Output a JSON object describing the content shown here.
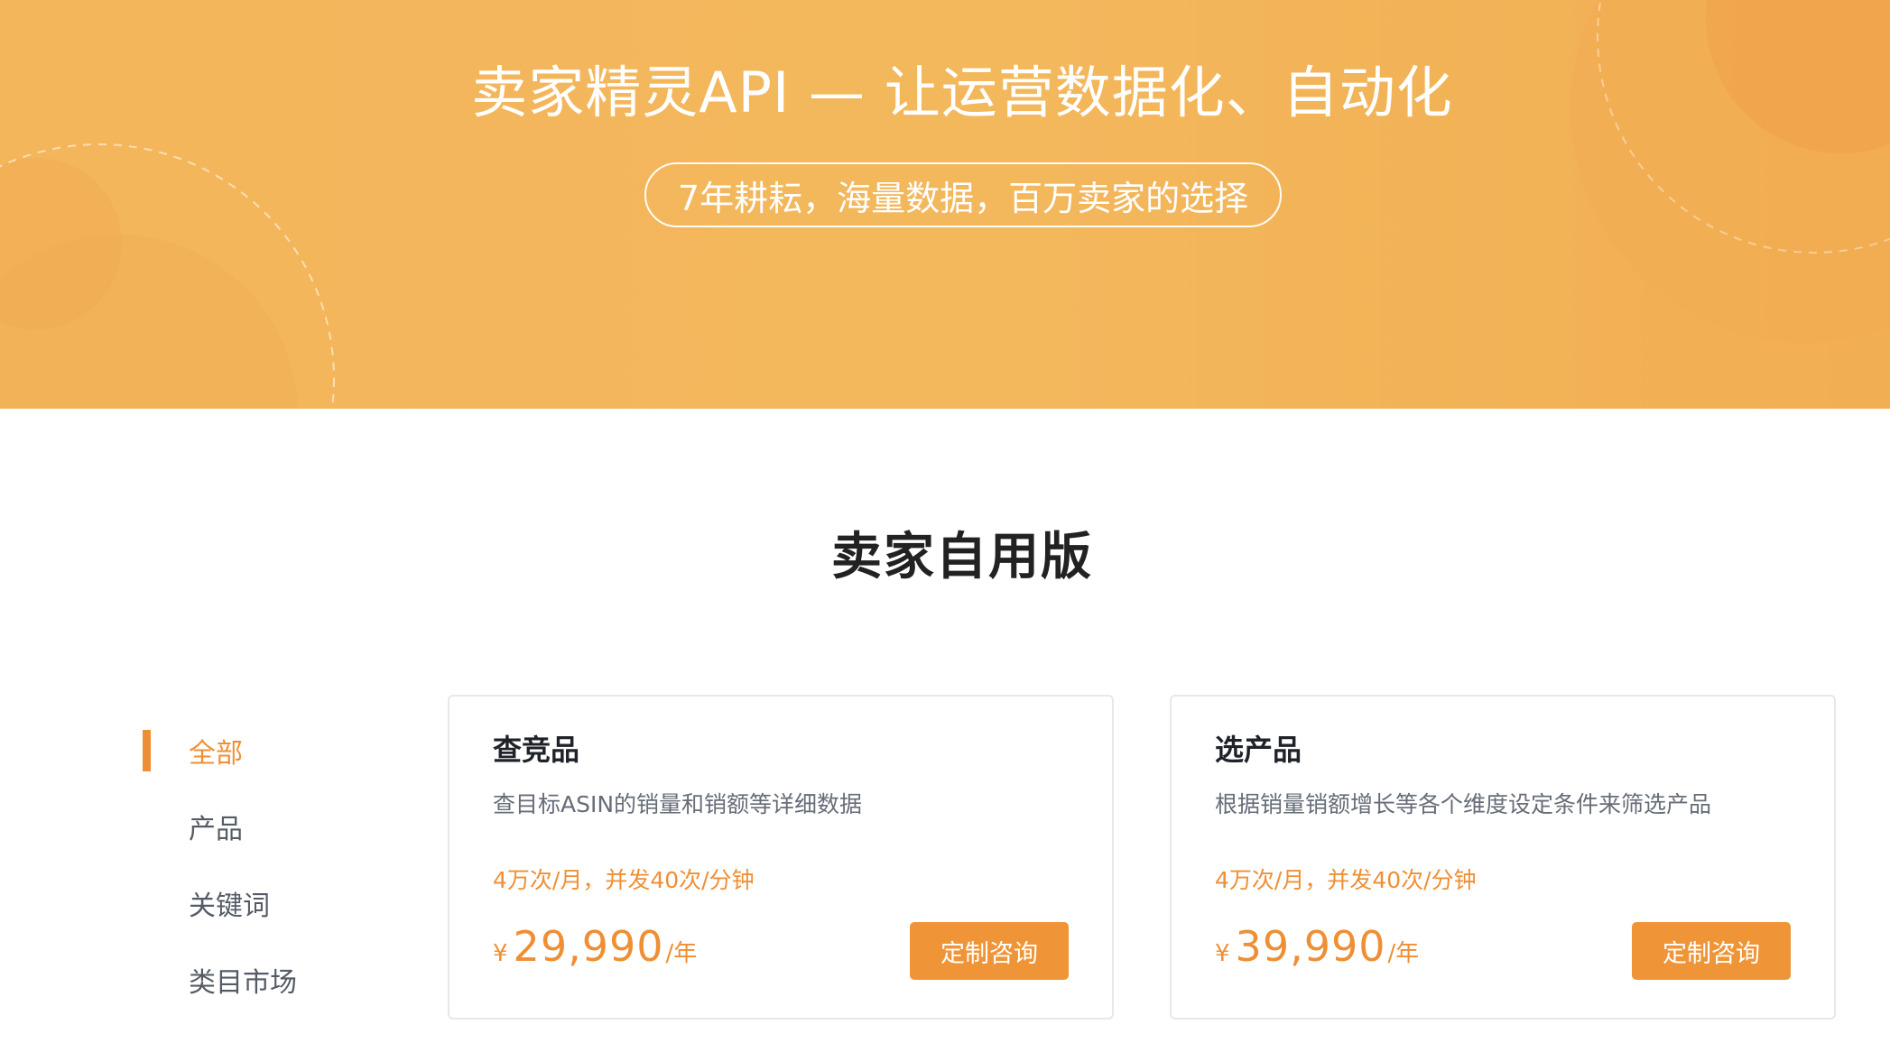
{
  "hero": {
    "title": "卖家精灵API — 让运营数据化、自动化",
    "subtitle": "7年耕耘，海量数据，百万卖家的选择"
  },
  "section": {
    "title": "卖家自用版"
  },
  "sidebar": {
    "items": [
      {
        "label": "全部",
        "active": true
      },
      {
        "label": "产品",
        "active": false
      },
      {
        "label": "关键词",
        "active": false
      },
      {
        "label": "类目市场",
        "active": false
      }
    ]
  },
  "cards": [
    {
      "title": "查竞品",
      "description": "查目标ASIN的销量和销额等详细数据",
      "quota": "4万次/月，并发40次/分钟",
      "currency": "¥",
      "price": "29,990",
      "unit": "/年",
      "button": "定制咨询"
    },
    {
      "title": "选产品",
      "description": "根据销量销额增长等各个维度设定条件来筛选产品",
      "quota": "4万次/月，并发40次/分钟",
      "currency": "¥",
      "price": "39,990",
      "unit": "/年",
      "button": "定制咨询"
    }
  ],
  "colors": {
    "accent": "#ef8f35",
    "hero_bg": "#f4b65b",
    "button_bg": "#ef9537"
  }
}
